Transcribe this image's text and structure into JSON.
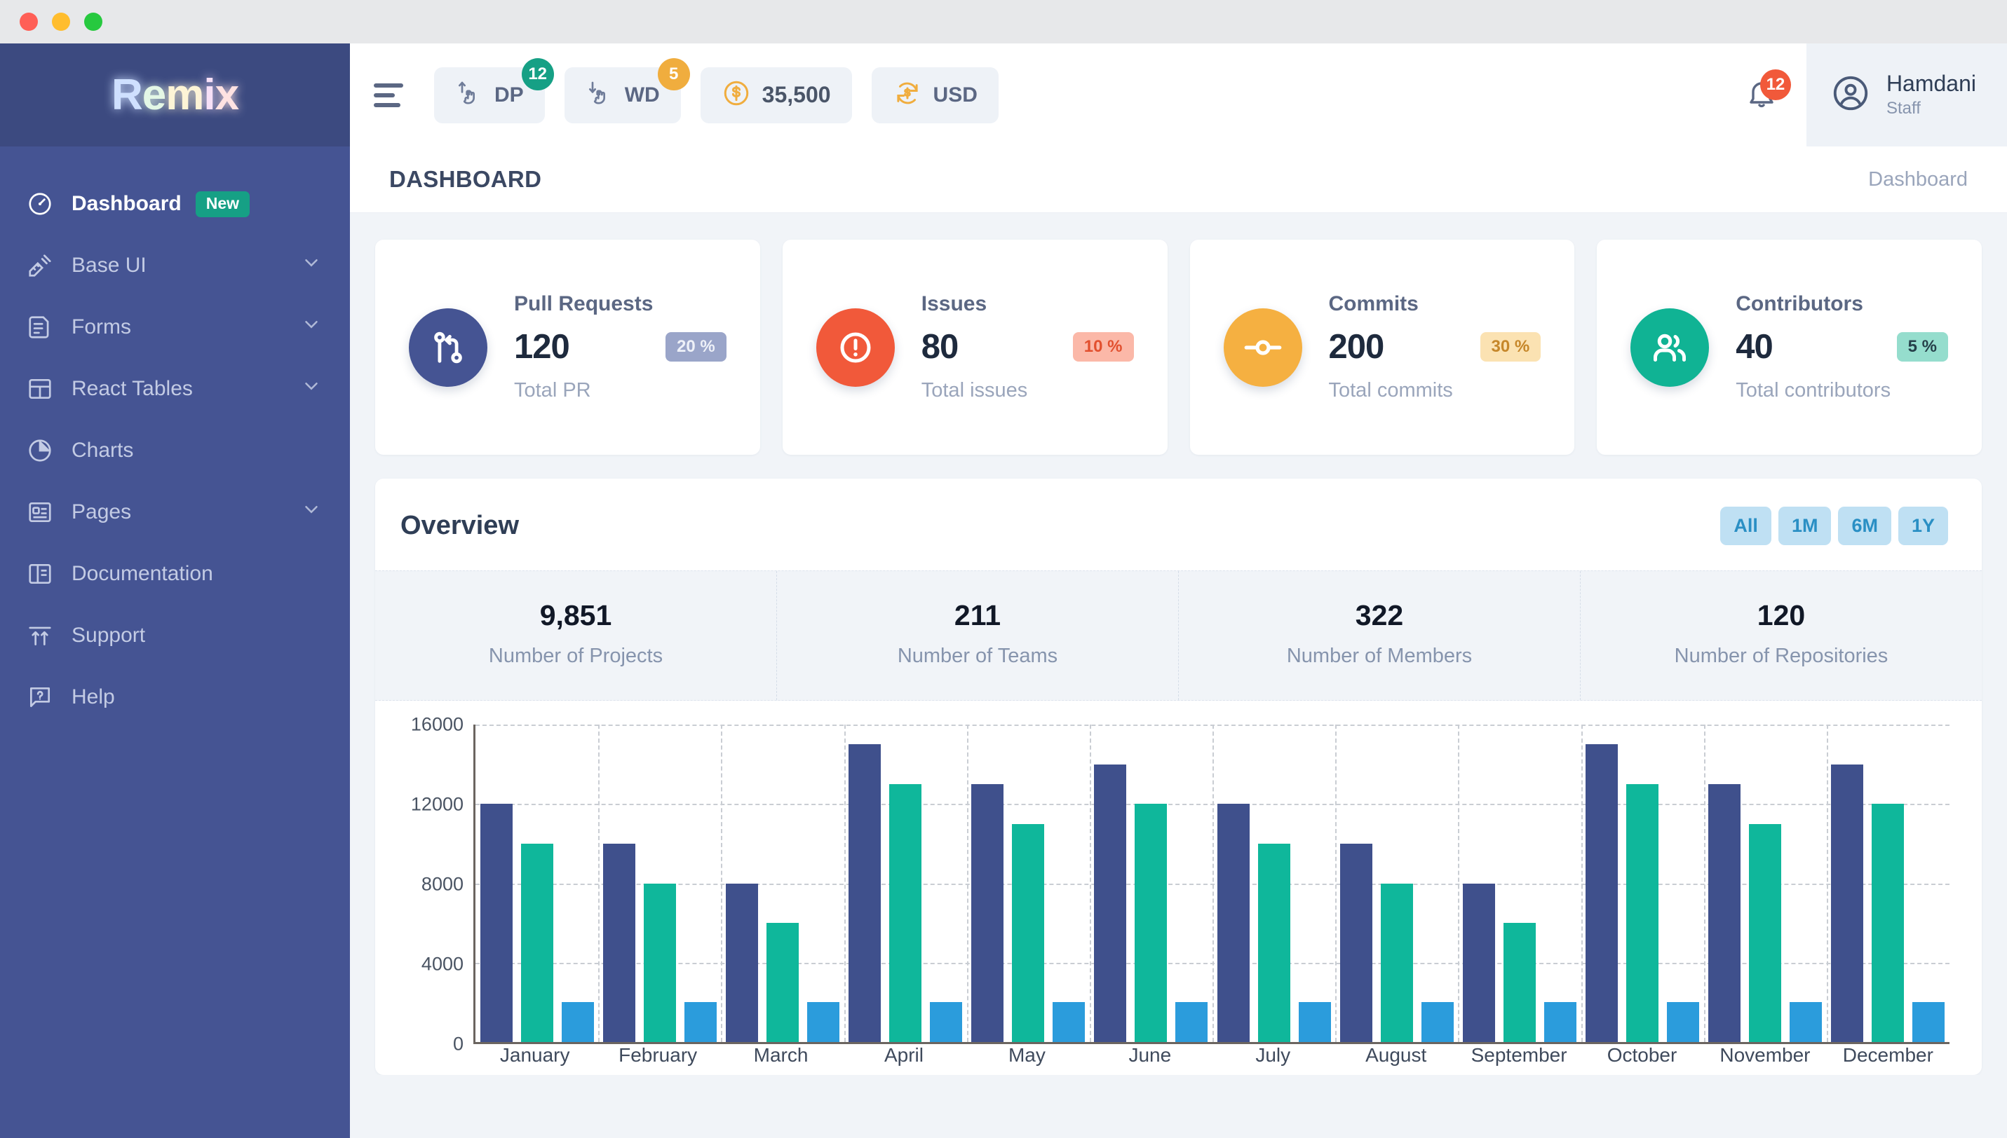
{
  "window": {
    "controls": [
      "close",
      "minimize",
      "maximize"
    ]
  },
  "sidebar": {
    "brand": {
      "r": "R",
      "e": "e",
      "m": "m",
      "i": "i",
      "x": "x"
    },
    "items": [
      {
        "label": "Dashboard",
        "icon": "gauge-icon",
        "badge": "New",
        "active": true,
        "expandable": false
      },
      {
        "label": "Base UI",
        "icon": "ruler-pen-icon",
        "badge": "",
        "active": false,
        "expandable": true
      },
      {
        "label": "Forms",
        "icon": "form-document-icon",
        "badge": "",
        "active": false,
        "expandable": true
      },
      {
        "label": "React Tables",
        "icon": "table-grid-icon",
        "badge": "",
        "active": false,
        "expandable": true
      },
      {
        "label": "Charts",
        "icon": "pie-chart-icon",
        "badge": "",
        "active": false,
        "expandable": false
      },
      {
        "label": "Pages",
        "icon": "page-layout-icon",
        "badge": "",
        "active": false,
        "expandable": true
      },
      {
        "label": "Documentation",
        "icon": "book-columns-icon",
        "badge": "",
        "active": false,
        "expandable": false
      },
      {
        "label": "Support",
        "icon": "arrows-up-icon",
        "badge": "",
        "active": false,
        "expandable": false
      },
      {
        "label": "Help",
        "icon": "question-chat-icon",
        "badge": "",
        "active": false,
        "expandable": false
      }
    ]
  },
  "topbar": {
    "menu_icon": "hamburger-icon",
    "pills": [
      {
        "label": "DP",
        "icon": "hand-deposit-icon",
        "badge": "12",
        "badge_color": "#16a085"
      },
      {
        "label": "WD",
        "icon": "hand-withdraw-icon",
        "badge": "5",
        "badge_color": "#f0ad3e"
      },
      {
        "label": "35,500",
        "icon": "dollar-coin-icon",
        "badge": "",
        "badge_color": ""
      },
      {
        "label": "USD",
        "icon": "currency-exchange-icon",
        "badge": "",
        "badge_color": ""
      }
    ],
    "notification": {
      "icon": "bell-icon",
      "count": "12",
      "color": "#f1593a"
    },
    "user": {
      "avatar_icon": "user-circle-icon",
      "name": "Hamdani",
      "role": "Staff"
    }
  },
  "page": {
    "title": "DASHBOARD",
    "breadcrumb": "Dashboard"
  },
  "cards": [
    {
      "title": "Pull Requests",
      "value": "120",
      "percent": "20 %",
      "subtitle": "Total PR",
      "icon": "git-pull-request-icon",
      "circle_color": "#455493",
      "badge_class": "p-indigo",
      "circle_class": "c-indigo"
    },
    {
      "title": "Issues",
      "value": "80",
      "percent": "10 %",
      "subtitle": "Total issues",
      "icon": "alert-circle-icon",
      "circle_color": "#f1593a",
      "badge_class": "p-red",
      "circle_class": "c-red"
    },
    {
      "title": "Commits",
      "value": "200",
      "percent": "30 %",
      "subtitle": "Total commits",
      "icon": "git-commit-icon",
      "circle_color": "#f5b041",
      "badge_class": "p-amber",
      "circle_class": "c-amber"
    },
    {
      "title": "Contributors",
      "value": "40",
      "percent": "5 %",
      "subtitle": "Total contributors",
      "icon": "users-icon",
      "circle_color": "#10b394",
      "badge_class": "p-teal",
      "circle_class": "c-teal"
    }
  ],
  "overview": {
    "title": "Overview",
    "filters": [
      "All",
      "1M",
      "6M",
      "1Y"
    ],
    "stats": [
      {
        "value": "9,851",
        "label": "Number of Projects"
      },
      {
        "value": "211",
        "label": "Number of Teams"
      },
      {
        "value": "322",
        "label": "Number of Members"
      },
      {
        "value": "120",
        "label": "Number of Repositories"
      }
    ]
  },
  "chart_data": {
    "type": "bar",
    "title": "Overview",
    "xlabel": "",
    "ylabel": "",
    "ylim": [
      0,
      16000
    ],
    "yticks": [
      0,
      4000,
      8000,
      12000,
      16000
    ],
    "grid": true,
    "legend": "none",
    "categories": [
      "January",
      "February",
      "March",
      "April",
      "May",
      "June",
      "July",
      "August",
      "September",
      "October",
      "November",
      "December"
    ],
    "series": [
      {
        "name": "series-1",
        "color": "#3f508c",
        "values": [
          12000,
          10000,
          8000,
          15000,
          13000,
          14000,
          12000,
          10000,
          8000,
          15000,
          13000,
          14000
        ]
      },
      {
        "name": "series-2",
        "color": "#0fb79b",
        "values": [
          10000,
          8000,
          6000,
          13000,
          11000,
          12000,
          10000,
          8000,
          6000,
          13000,
          11000,
          12000
        ]
      },
      {
        "name": "series-3",
        "color": "#2b9cdc",
        "values": [
          2000,
          2000,
          2000,
          2000,
          2000,
          2000,
          2000,
          2000,
          2000,
          2000,
          2000,
          2000
        ]
      }
    ]
  }
}
